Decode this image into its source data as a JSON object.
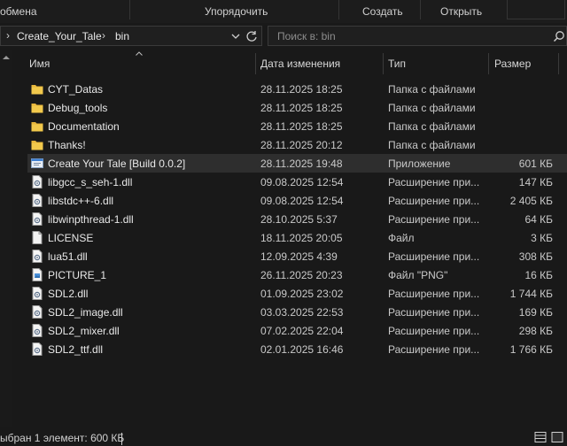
{
  "toolbar": {
    "share_label": "обмена",
    "sort_label": "Упорядочить",
    "create_label": "Создать",
    "open_label": "Открыть"
  },
  "address": {
    "crumbs": [
      "Create_Your_Tale",
      "bin"
    ]
  },
  "search": {
    "placeholder": "Поиск в: bin"
  },
  "columns": {
    "name": "Имя",
    "date": "Дата изменения",
    "type": "Тип",
    "size": "Размер"
  },
  "files": [
    {
      "name": "CYT_Datas",
      "date": "28.11.2025 18:25",
      "type": "Папка с файлами",
      "size": "",
      "icon": "folder-icon"
    },
    {
      "name": "Debug_tools",
      "date": "28.11.2025 18:25",
      "type": "Папка с файлами",
      "size": "",
      "icon": "folder-icon"
    },
    {
      "name": "Documentation",
      "date": "28.11.2025 18:25",
      "type": "Папка с файлами",
      "size": "",
      "icon": "folder-icon"
    },
    {
      "name": "Thanks!",
      "date": "28.11.2025 20:12",
      "type": "Папка с файлами",
      "size": "",
      "icon": "folder-icon"
    },
    {
      "name": "Create Your Tale [Build 0.0.2]",
      "date": "28.11.2025 19:48",
      "type": "Приложение",
      "size": "601 КБ",
      "icon": "application-icon",
      "selected": true
    },
    {
      "name": "libgcc_s_seh-1.dll",
      "date": "09.08.2025 12:54",
      "type": "Расширение при...",
      "size": "147 КБ",
      "icon": "dll-file-icon"
    },
    {
      "name": "libstdc++-6.dll",
      "date": "09.08.2025 12:54",
      "type": "Расширение при...",
      "size": "2 405 КБ",
      "icon": "dll-file-icon"
    },
    {
      "name": "libwinpthread-1.dll",
      "date": "28.10.2025 5:37",
      "type": "Расширение при...",
      "size": "64 КБ",
      "icon": "dll-file-icon"
    },
    {
      "name": "LICENSE",
      "date": "18.11.2025 20:05",
      "type": "Файл",
      "size": "3 КБ",
      "icon": "file-icon"
    },
    {
      "name": "lua51.dll",
      "date": "12.09.2025 4:39",
      "type": "Расширение при...",
      "size": "308 КБ",
      "icon": "dll-file-icon"
    },
    {
      "name": "PICTURE_1",
      "date": "26.11.2025 20:23",
      "type": "Файл \"PNG\"",
      "size": "16 КБ",
      "icon": "image-file-icon"
    },
    {
      "name": "SDL2.dll",
      "date": "01.09.2025 23:02",
      "type": "Расширение при...",
      "size": "1 744 КБ",
      "icon": "dll-file-icon"
    },
    {
      "name": "SDL2_image.dll",
      "date": "03.03.2025 22:53",
      "type": "Расширение при...",
      "size": "169 КБ",
      "icon": "dll-file-icon"
    },
    {
      "name": "SDL2_mixer.dll",
      "date": "07.02.2025 22:04",
      "type": "Расширение при...",
      "size": "298 КБ",
      "icon": "dll-file-icon"
    },
    {
      "name": "SDL2_ttf.dll",
      "date": "02.01.2025 16:46",
      "type": "Расширение при...",
      "size": "1 766 КБ",
      "icon": "dll-file-icon"
    }
  ],
  "status": {
    "text": "ыбран 1 элемент: 600 КБ"
  },
  "colors": {
    "background": "#191919",
    "selected_row": "#2e2e2e",
    "folder": "#e8b73c",
    "text": "#e8e8e8"
  }
}
